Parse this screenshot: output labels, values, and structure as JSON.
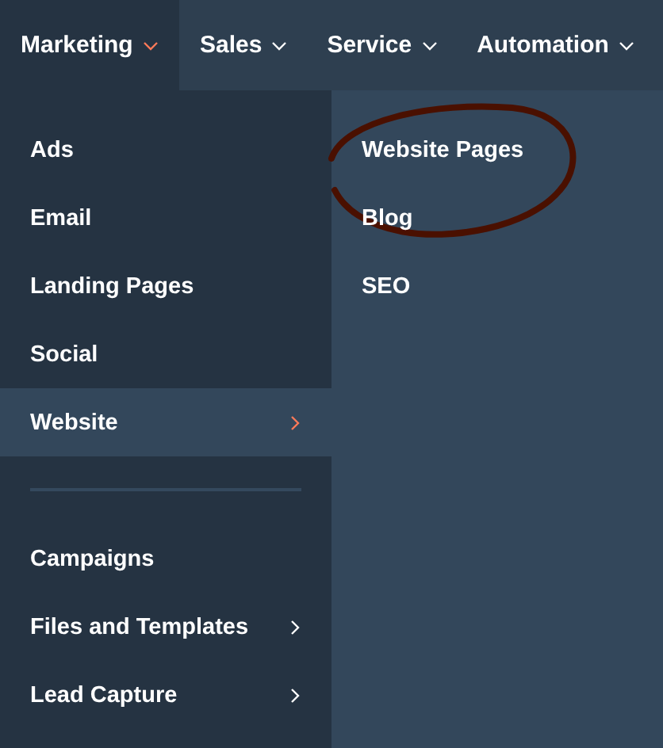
{
  "nav": {
    "tabs": [
      {
        "label": "Marketing",
        "selected": true
      },
      {
        "label": "Sales",
        "selected": false
      },
      {
        "label": "Service",
        "selected": false
      },
      {
        "label": "Automation",
        "selected": false
      }
    ]
  },
  "menu": {
    "sections": [
      {
        "items": [
          {
            "label": "Ads",
            "selected": false,
            "has_submenu": false
          },
          {
            "label": "Email",
            "selected": false,
            "has_submenu": false
          },
          {
            "label": "Landing Pages",
            "selected": false,
            "has_submenu": false
          },
          {
            "label": "Social",
            "selected": false,
            "has_submenu": false
          },
          {
            "label": "Website",
            "selected": true,
            "has_submenu": true
          }
        ]
      },
      {
        "items": [
          {
            "label": "Campaigns",
            "selected": false,
            "has_submenu": false
          },
          {
            "label": "Files and Templates",
            "selected": false,
            "has_submenu": true
          },
          {
            "label": "Lead Capture",
            "selected": false,
            "has_submenu": true
          }
        ]
      }
    ]
  },
  "submenu": {
    "items": [
      {
        "label": "Website Pages"
      },
      {
        "label": "Blog"
      },
      {
        "label": "SEO"
      }
    ]
  },
  "annotation": {
    "kind": "circle"
  }
}
